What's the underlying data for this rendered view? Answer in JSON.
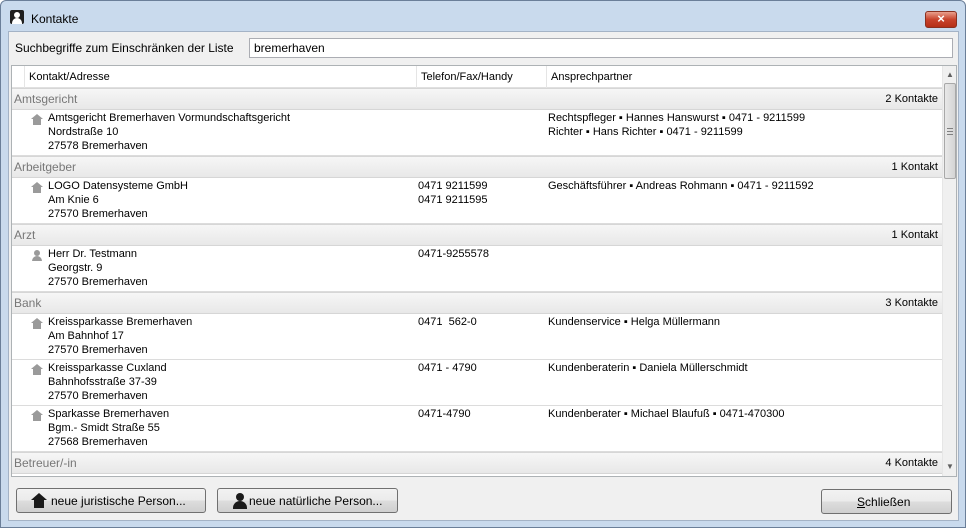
{
  "window": {
    "title": "Kontakte",
    "close_glyph": "×"
  },
  "search": {
    "label": "Suchbegriffe zum Einschränken der Liste",
    "value": "bremerhaven"
  },
  "columns": [
    "Kontakt/Adresse",
    "Telefon/Fax/Handy",
    "Ansprechpartner"
  ],
  "groups": [
    {
      "name": "Amtsgericht",
      "count": "2 Kontakte"
    },
    {
      "name": "Arbeitgeber",
      "count": "1 Kontakt"
    },
    {
      "name": "Arzt",
      "count": "1 Kontakt"
    },
    {
      "name": "Bank",
      "count": "3 Kontakte"
    },
    {
      "name": "Betreuer/-in",
      "count": "4 Kontakte"
    }
  ],
  "entries": [
    {
      "icon": "house-icon",
      "address": [
        "Amtsgericht Bremerhaven Vormundschaftsgericht",
        "Nordstraße 10",
        "27578 Bremerhaven"
      ],
      "phone": [],
      "contacts": [
        "Rechtspfleger ▪ Hannes Hanswurst ▪ 0471 - 9211599",
        "Richter ▪ Hans Richter ▪ 0471 - 9211599"
      ]
    },
    {
      "icon": "house-icon",
      "address": [
        "LOGO Datensysteme GmbH",
        "Am Knie 6",
        "27570 Bremerhaven"
      ],
      "phone": [
        "0471 9211599",
        "0471 9211595"
      ],
      "contacts": [
        "Geschäftsführer ▪ Andreas Rohmann ▪ 0471 - 9211592"
      ]
    },
    {
      "icon": "person-icon",
      "address": [
        "Herr Dr. Testmann",
        "Georgstr. 9",
        "27570 Bremerhaven"
      ],
      "phone": [
        "0471-9255578"
      ],
      "contacts": []
    },
    {
      "icon": "house-icon",
      "address": [
        "Kreissparkasse Bremerhaven",
        "Am Bahnhof 17",
        "27570 Bremerhaven"
      ],
      "phone": [
        "0471  562-0"
      ],
      "contacts": [
        "Kundenservice ▪ Helga Müllermann"
      ]
    },
    {
      "icon": "house-icon",
      "address": [
        "Kreissparkasse Cuxland",
        "Bahnhofsstraße 37-39",
        "27570 Bremerhaven"
      ],
      "phone": [
        "0471 - 4790"
      ],
      "contacts": [
        "Kundenberaterin ▪ Daniela Müllerschmidt"
      ]
    },
    {
      "icon": "house-icon",
      "address": [
        "Sparkasse Bremerhaven",
        "Bgm.- Smidt Straße 55",
        "27568 Bremerhaven"
      ],
      "phone": [
        "0471-4790"
      ],
      "contacts": [
        "Kundenberater ▪ Michael Blaufuß ▪ 0471-470300"
      ]
    }
  ],
  "scrollbar": {
    "up_glyph": "▲",
    "down_glyph": "▼"
  },
  "buttons": {
    "new_legal": "neue juristische Person...",
    "new_natural": "neue natürliche Person...",
    "close_first": "S",
    "close_rest": "chließen"
  }
}
